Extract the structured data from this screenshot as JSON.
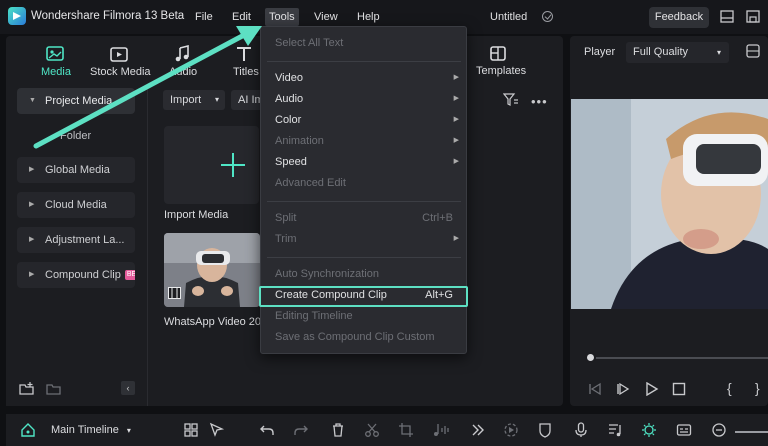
{
  "app": {
    "title": "Wondershare Filmora 13 Beta",
    "document_title": "Untitled",
    "feedback_label": "Feedback",
    "accent_color": "#4fe6c6",
    "highlight_color": "#5de0c3"
  },
  "menubar": [
    {
      "label": "File"
    },
    {
      "label": "Edit"
    },
    {
      "label": "Tools"
    },
    {
      "label": "View"
    },
    {
      "label": "Help"
    }
  ],
  "tabs": {
    "media": "Media",
    "stock_media": "Stock Media",
    "audio": "Audio",
    "titles": "Titles",
    "templates": "Templates"
  },
  "sidebar": {
    "items": [
      {
        "label": "Project Media"
      },
      {
        "label": "Global Media"
      },
      {
        "label": "Cloud Media"
      },
      {
        "label": "Adjustment La..."
      },
      {
        "label": "Compound Clip",
        "badge": "BE"
      }
    ],
    "folder_label": "Folder"
  },
  "toolbar": {
    "import_label": "Import",
    "ai_label": "AI Im"
  },
  "media": {
    "import_label": "Import Media",
    "video_label": "WhatsApp Video 2023"
  },
  "tools_menu": {
    "items": [
      {
        "label": "Select All Text",
        "disabled": true
      },
      {
        "label": "Video",
        "submenu": true
      },
      {
        "label": "Audio",
        "submenu": true
      },
      {
        "label": "Color",
        "submenu": true
      },
      {
        "label": "Animation",
        "disabled": true,
        "submenu": true
      },
      {
        "label": "Speed",
        "submenu": true
      },
      {
        "label": "Advanced Edit",
        "disabled": true
      },
      {
        "label": "Split",
        "shortcut": "Ctrl+B",
        "disabled": true
      },
      {
        "label": "Trim",
        "disabled": true,
        "submenu": true
      },
      {
        "label": "Auto Synchronization",
        "disabled": true
      },
      {
        "label": "Create Compound Clip",
        "shortcut": "Alt+G",
        "highlighted": true
      },
      {
        "label": "Editing Timeline",
        "disabled": true
      },
      {
        "label": "Save as Compound Clip Custom",
        "disabled": true
      }
    ]
  },
  "player": {
    "label": "Player",
    "quality": "Full Quality"
  },
  "bottombar": {
    "timeline_label": "Main Timeline"
  }
}
